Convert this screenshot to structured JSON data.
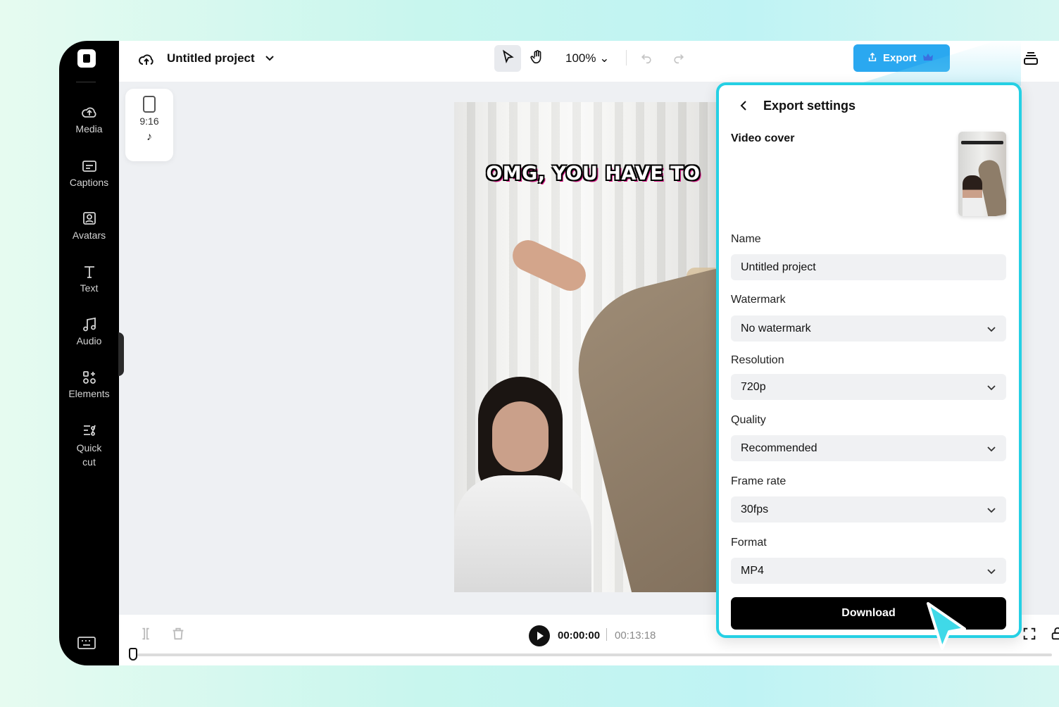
{
  "sidebar": {
    "items": [
      {
        "label": "Media",
        "icon": "cloud-upload-icon"
      },
      {
        "label": "Captions",
        "icon": "captions-icon"
      },
      {
        "label": "Avatars",
        "icon": "avatar-icon"
      },
      {
        "label": "Text",
        "icon": "text-icon"
      },
      {
        "label": "Audio",
        "icon": "music-note-icon"
      },
      {
        "label": "Elements",
        "icon": "elements-icon"
      },
      {
        "label": "Quick cut",
        "icon": "quick-cut-icon"
      }
    ]
  },
  "topbar": {
    "project_title": "Untitled project",
    "zoom": "100%",
    "export_label": "Export"
  },
  "canvas": {
    "ratio": "9:16",
    "caption": "OMG, YOU HAVE TO"
  },
  "playback": {
    "current_time": "00:00:00",
    "total_time": "00:13:18"
  },
  "export_panel": {
    "title": "Export settings",
    "video_cover_label": "Video cover",
    "name_label": "Name",
    "name_value": "Untitled project",
    "watermark_label": "Watermark",
    "watermark_value": "No watermark",
    "resolution_label": "Resolution",
    "resolution_value": "720p",
    "quality_label": "Quality",
    "quality_value": "Recommended",
    "frame_rate_label": "Frame rate",
    "frame_rate_value": "30fps",
    "format_label": "Format",
    "format_value": "MP4",
    "download_label": "Download"
  },
  "colors": {
    "accent": "#25d0e4",
    "export_button": "#2aa8f0",
    "sidebar": "#000000"
  }
}
